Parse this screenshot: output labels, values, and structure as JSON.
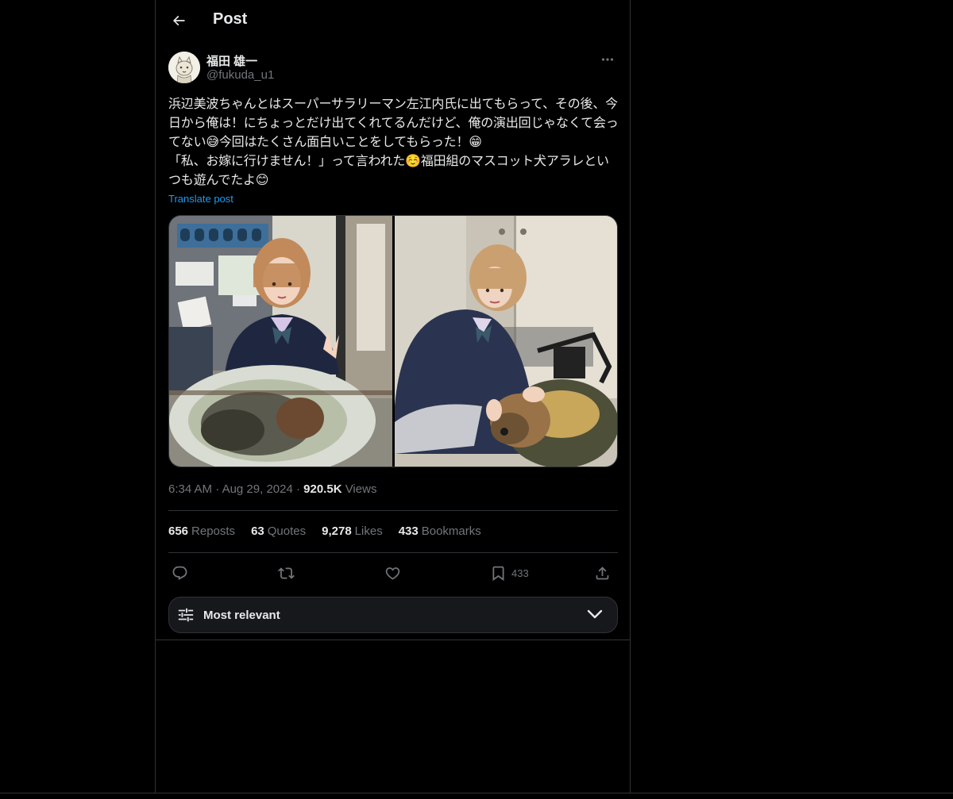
{
  "header": {
    "title": "Post",
    "back_icon": "arrow-left-icon"
  },
  "author": {
    "display_name": "福田 雄一",
    "handle": "@fukuda_u1",
    "more_icon": "more-horizontal-icon"
  },
  "post": {
    "text": "浜辺美波ちゃんとはスーパーサラリーマン左江内氏に出てもらって、その後、今日から俺は！にちょっとだけ出てくれてるんだけど、俺の演出回じゃなくて会ってない😅今回はたくさん面白いことをしてもらった！😁\n「私、お嫁に行けません！」って言われた☺️福田組のマスコット犬アラレといつも遊んでたよ😊",
    "translate_label": "Translate post",
    "time": "6:34 AM",
    "date": "Aug 29, 2024",
    "views_count": "920.5K",
    "views_label": "Views"
  },
  "stats": {
    "reposts_count": "656",
    "reposts_label": "Reposts",
    "quotes_count": "63",
    "quotes_label": "Quotes",
    "likes_count": "9,278",
    "likes_label": "Likes",
    "bookmarks_count": "433",
    "bookmarks_label": "Bookmarks"
  },
  "actions": {
    "reply_icon": "reply-icon",
    "repost_icon": "repost-icon",
    "like_icon": "heart-icon",
    "bookmark_icon": "bookmark-icon",
    "bookmark_count": "433",
    "share_icon": "share-icon"
  },
  "replies_sort": {
    "label": "Most relevant",
    "icon": "sliders-icon",
    "chevron": "chevron-down-icon"
  },
  "colors": {
    "background": "#000000",
    "text_primary": "#e7e9ea",
    "text_secondary": "#71767b",
    "accent": "#1d9bf0",
    "border": "#2f3336",
    "sort_bar_bg": "#16181c"
  }
}
